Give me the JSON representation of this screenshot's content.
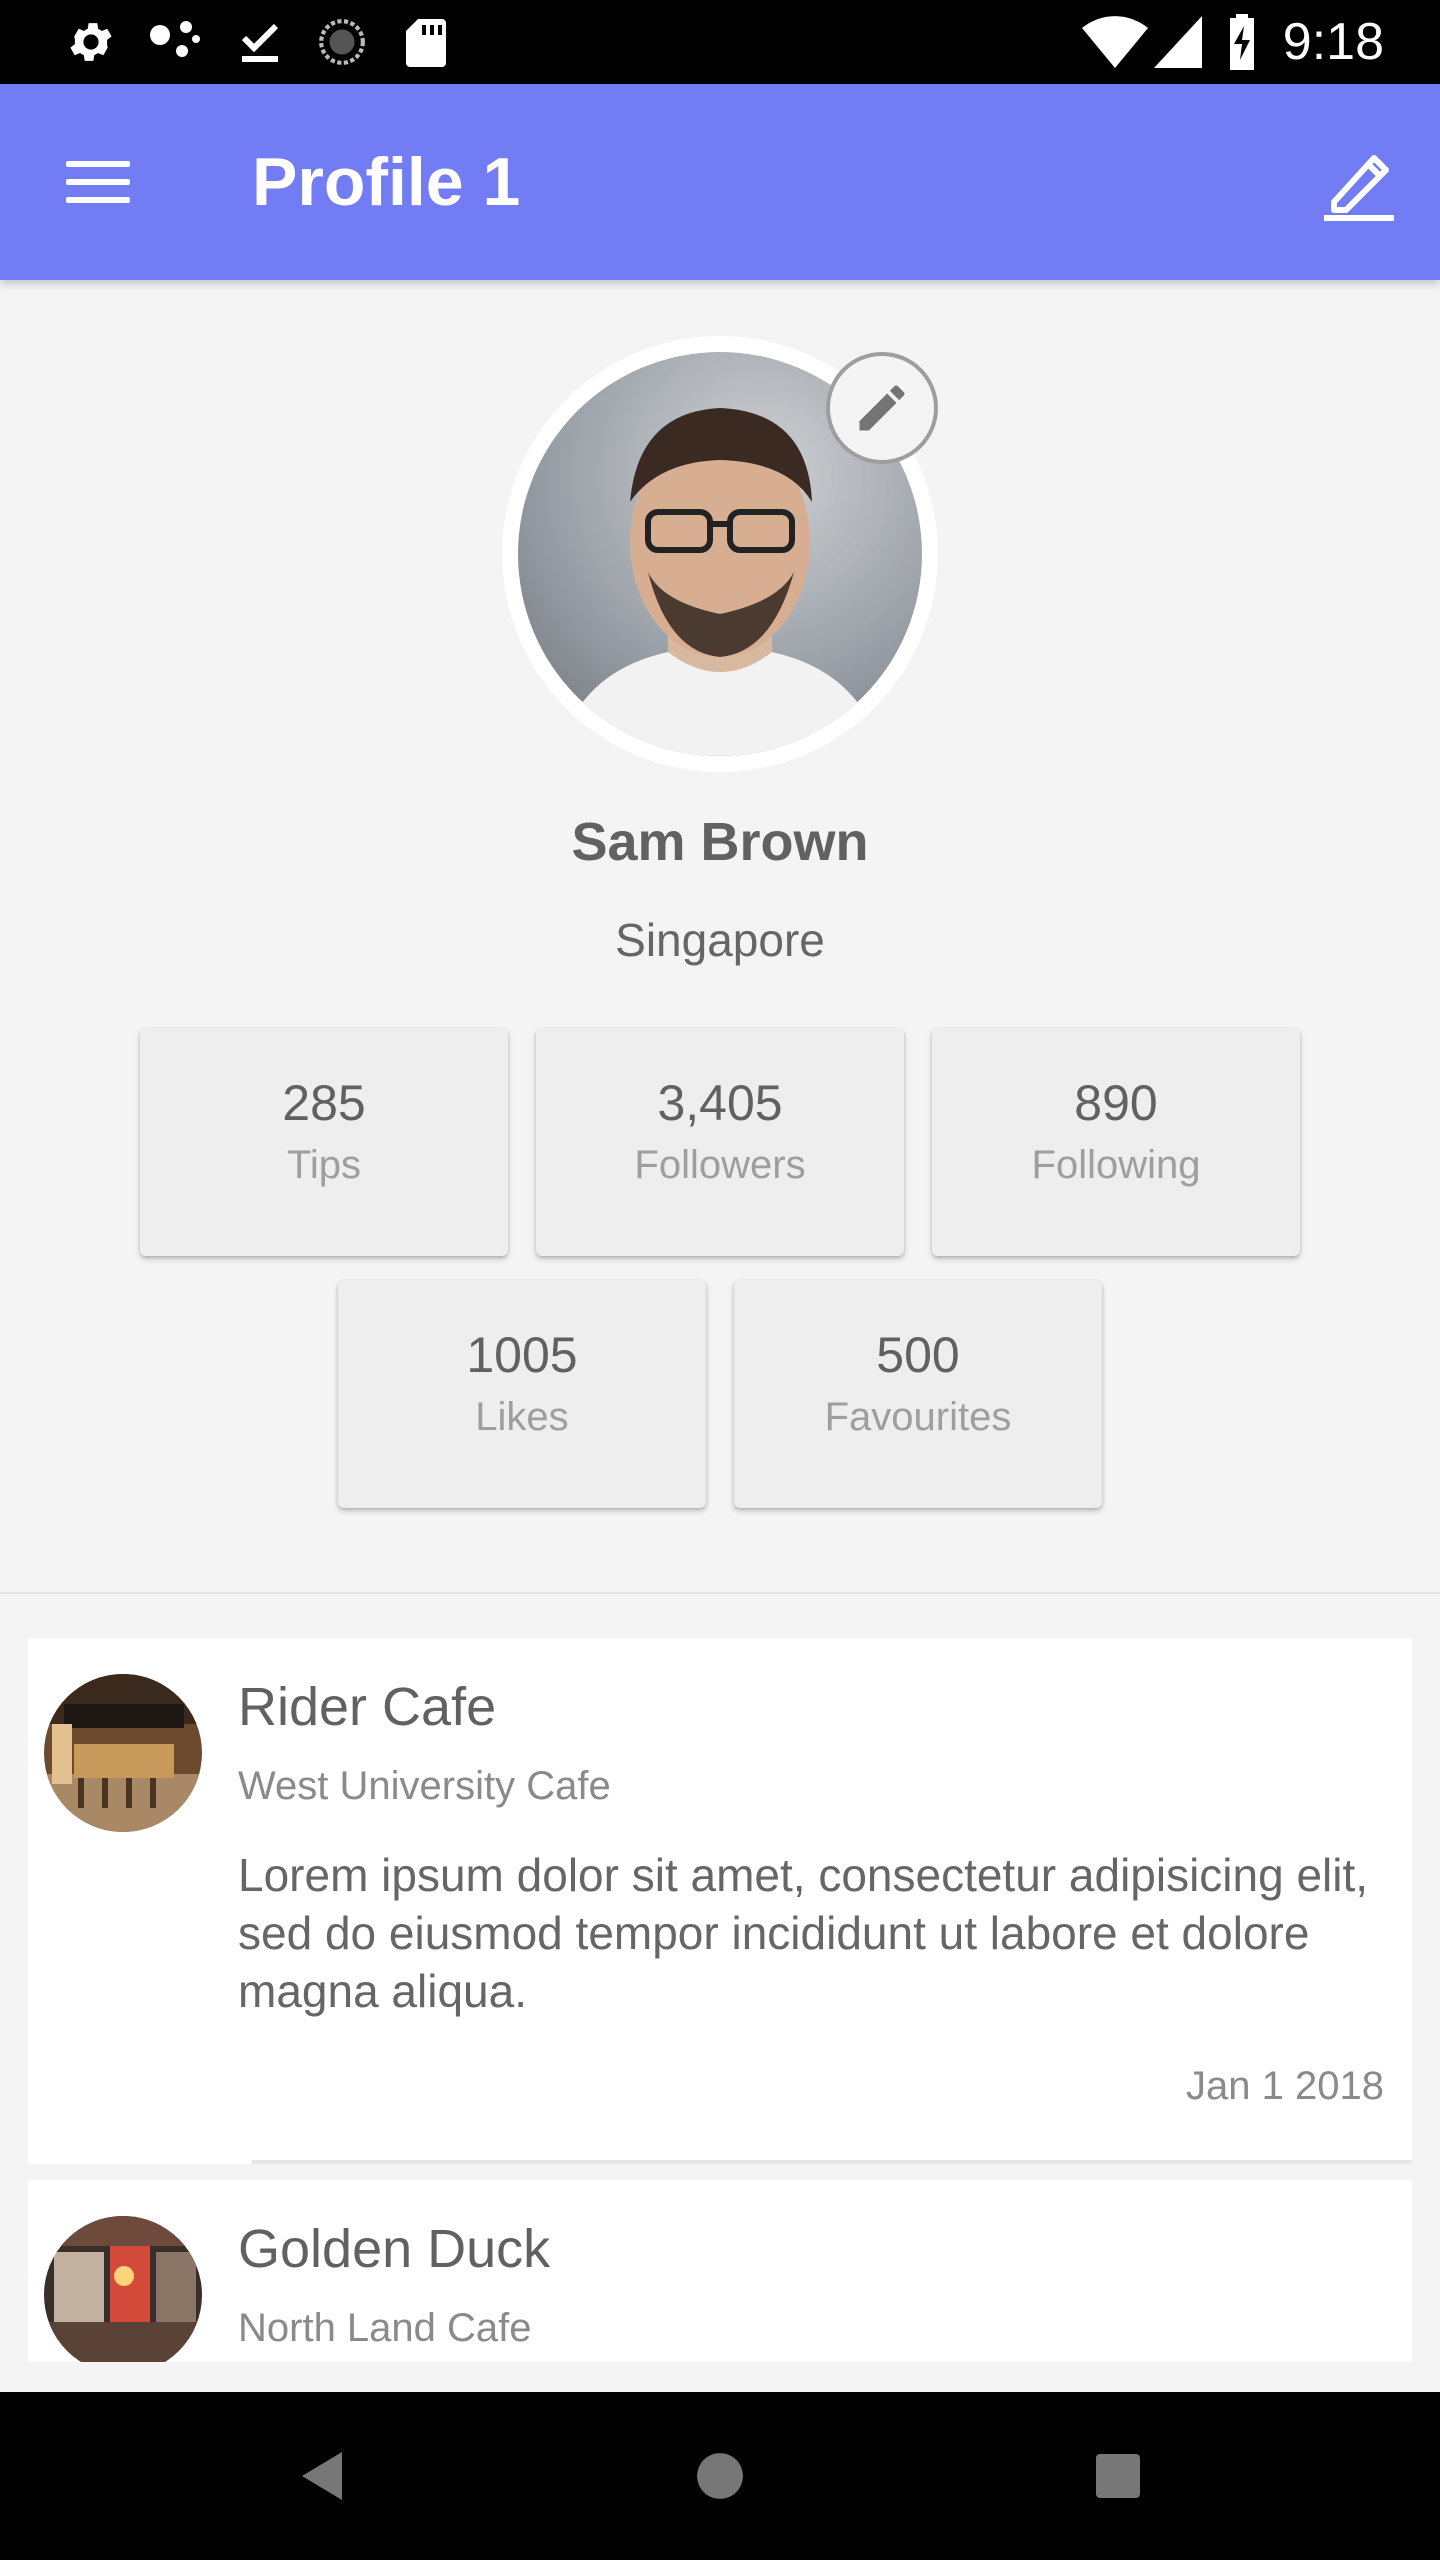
{
  "status_bar": {
    "time": "9:18",
    "icons": [
      "settings-icon",
      "dots-icon",
      "download-done-icon",
      "sync-icon",
      "sd-card-icon",
      "wifi-icon",
      "signal-icon",
      "battery-charging-icon"
    ]
  },
  "app_bar": {
    "title": "Profile 1",
    "menu_icon": "hamburger-menu-icon",
    "edit_icon": "pencil-icon"
  },
  "profile": {
    "name": "Sam Brown",
    "location": "Singapore"
  },
  "stats": [
    {
      "value": "285",
      "label": "Tips"
    },
    {
      "value": "3,405",
      "label": "Followers"
    },
    {
      "value": "890",
      "label": "Following"
    },
    {
      "value": "1005",
      "label": "Likes"
    },
    {
      "value": "500",
      "label": "Favourites"
    }
  ],
  "feed": [
    {
      "title": "Rider Cafe",
      "subtitle": "West University Cafe",
      "body": "Lorem ipsum dolor sit amet, consectetur adipisicing elit, sed do eiusmod tempor incididunt ut labore et dolore magna aliqua.",
      "date": "Jan 1 2018"
    },
    {
      "title": "Golden Duck",
      "subtitle": "North Land Cafe"
    }
  ],
  "colors": {
    "app_bar": "#727cf5",
    "background": "#f4f4f4"
  }
}
